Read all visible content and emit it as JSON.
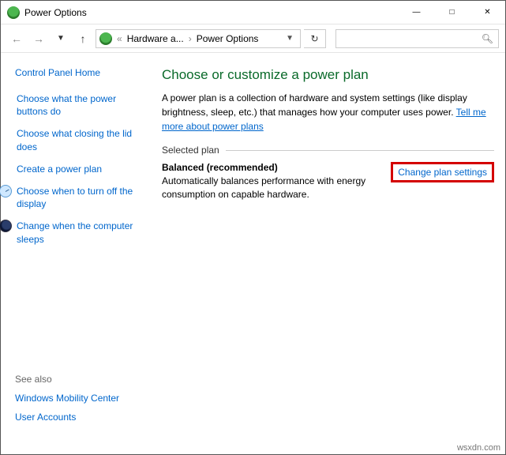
{
  "window": {
    "title": "Power Options"
  },
  "breadcrumb": {
    "level1": "Hardware a...",
    "level2": "Power Options"
  },
  "search": {
    "placeholder": ""
  },
  "sidebar": {
    "home": "Control Panel Home",
    "items": [
      {
        "label": "Choose what the power buttons do",
        "icon": ""
      },
      {
        "label": "Choose what closing the lid does",
        "icon": ""
      },
      {
        "label": "Create a power plan",
        "icon": ""
      },
      {
        "label": "Choose when to turn off the display",
        "icon": "clock"
      },
      {
        "label": "Change when the computer sleeps",
        "icon": "moon"
      }
    ],
    "seealso_heading": "See also",
    "seealso": [
      "Windows Mobility Center",
      "User Accounts"
    ]
  },
  "content": {
    "heading": "Choose or customize a power plan",
    "description": "A power plan is a collection of hardware and system settings (like display brightness, sleep, etc.) that manages how your computer uses power. ",
    "learn_more": "Tell me more about power plans",
    "section": "Selected plan",
    "plan_name": "Balanced (recommended)",
    "plan_desc": "Automatically balances performance with energy consumption on capable hardware.",
    "change_link": "Change plan settings"
  },
  "watermark": "wsxdn.com"
}
